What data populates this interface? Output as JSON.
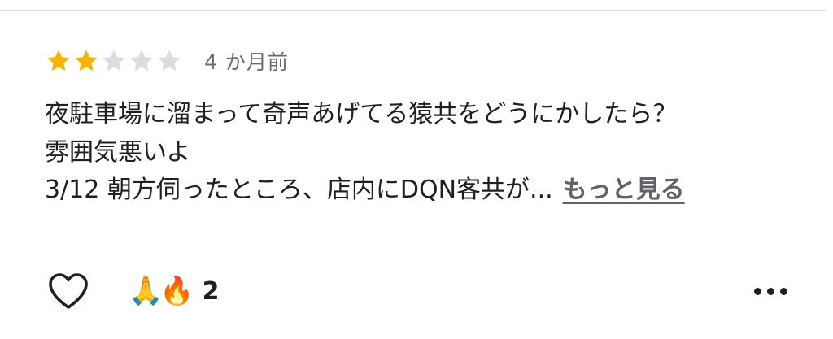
{
  "review": {
    "rating": 2,
    "max_rating": 5,
    "date": "4 か月前",
    "text_lines": [
      "夜駐車場に溜まって奇声あげてる猿共をどうにかしたら？",
      "雰囲気悪いよ",
      "3/12 朝方伺ったところ、店内にDQN客共が..."
    ],
    "more_label": "もっと見る"
  },
  "actions": {
    "like_icon": "heart-outline-icon",
    "reaction_emojis": "🙏🔥",
    "reaction_count": "2",
    "more_options_icon": "more-horizontal-icon"
  },
  "colors": {
    "star_filled": "#f4b400",
    "star_empty": "#dadce0",
    "text": "#1f1f1f",
    "muted": "#6b6b6b",
    "link": "#5f6368"
  }
}
